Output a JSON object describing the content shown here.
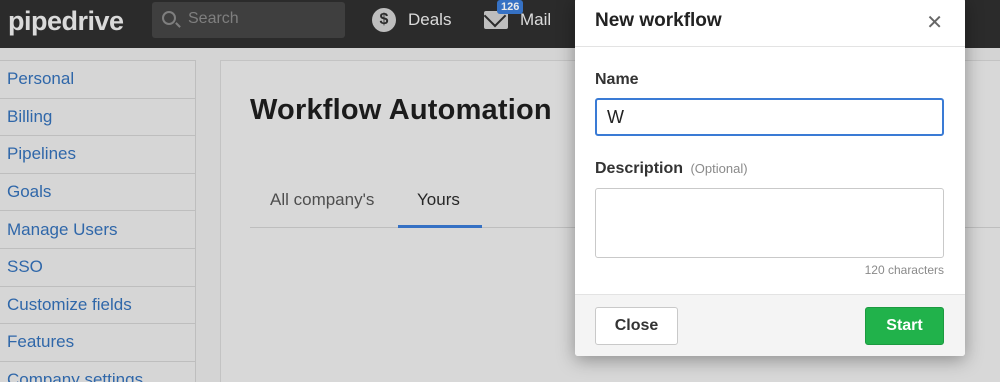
{
  "topbar": {
    "logo": "pipedrive",
    "search_placeholder": "Search",
    "nav": [
      {
        "label": "Deals",
        "icon": "dollar-icon"
      },
      {
        "label": "Mail",
        "icon": "mail-icon",
        "badge": "126"
      }
    ]
  },
  "sidebar": {
    "items": [
      {
        "label": "Personal"
      },
      {
        "label": "Billing"
      },
      {
        "label": "Pipelines"
      },
      {
        "label": "Goals"
      },
      {
        "label": "Manage Users"
      },
      {
        "label": "SSO"
      },
      {
        "label": "Customize fields"
      },
      {
        "label": "Features"
      },
      {
        "label": "Company settings"
      }
    ]
  },
  "main": {
    "title": "Workflow Automation",
    "tabs": [
      {
        "label": "All company's"
      },
      {
        "label": "Yours",
        "active": true
      }
    ]
  },
  "modal": {
    "title": "New workflow",
    "close_icon": "close-icon",
    "name_label": "Name",
    "name_value": "W",
    "description_label": "Description",
    "description_optional": "(Optional)",
    "description_value": "",
    "char_count": "120 characters",
    "close_button": "Close",
    "start_button": "Start"
  },
  "colors": {
    "accent": "#3a7bd5",
    "start_green": "#21b24b",
    "topbar": "#2f2f2f",
    "link": "#3470b8"
  }
}
